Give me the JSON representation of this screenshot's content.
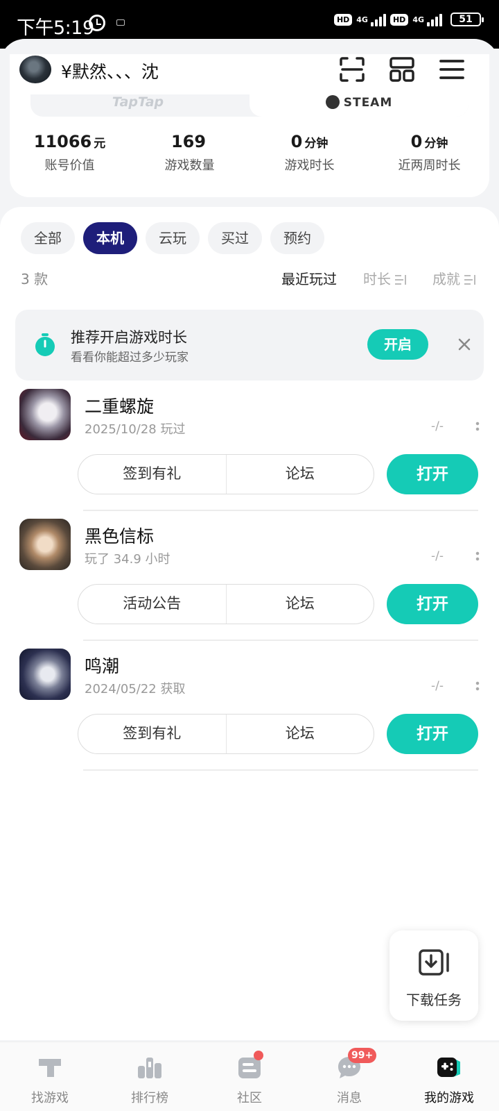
{
  "status_bar": {
    "time": "下午5:19",
    "network_1": "4G",
    "network_2": "4G",
    "hd_1": "HD",
    "hd_2": "HD",
    "battery": "51"
  },
  "header": {
    "username": "¥默然、、、沈",
    "source_tabs": [
      "TapTap",
      "STEAM"
    ]
  },
  "stats": [
    {
      "value": "11066",
      "unit": "元",
      "label": "账号价值"
    },
    {
      "value": "169",
      "unit": "",
      "label": "游戏数量"
    },
    {
      "value": "0",
      "unit": "分钟",
      "label": "游戏时长"
    },
    {
      "value": "0",
      "unit": "分钟",
      "label": "近两周时长"
    }
  ],
  "filters": [
    "全部",
    "本机",
    "云玩",
    "买过",
    "预约"
  ],
  "active_filter": "本机",
  "list": {
    "count": "3 款",
    "sort_options": [
      "最近玩过",
      "时长",
      "成就"
    ]
  },
  "recommend": {
    "title": "推荐开启游戏时长",
    "subtitle": "看看你能超过多少玩家",
    "button": "开启"
  },
  "games": [
    {
      "name": "二重螺旋",
      "meta": "2025/10/28 玩过",
      "dash": "-/-",
      "actions": [
        "签到有礼",
        "论坛"
      ],
      "open": "打开"
    },
    {
      "name": "黑色信标",
      "meta": "玩了 34.9 小时",
      "dash": "-/-",
      "actions": [
        "活动公告",
        "论坛"
      ],
      "open": "打开"
    },
    {
      "name": "鸣潮",
      "meta": "2024/05/22 获取",
      "dash": "-/-",
      "actions": [
        "签到有礼",
        "论坛"
      ],
      "open": "打开"
    }
  ],
  "download": {
    "label": "下载任务"
  },
  "nav": {
    "items": [
      "找游戏",
      "排行榜",
      "社区",
      "消息",
      "我的游戏"
    ],
    "message_badge": "99+"
  },
  "colors": {
    "accent": "#15cbb6",
    "active_chip": "#1e1e7a",
    "badge": "#f05a5a"
  }
}
